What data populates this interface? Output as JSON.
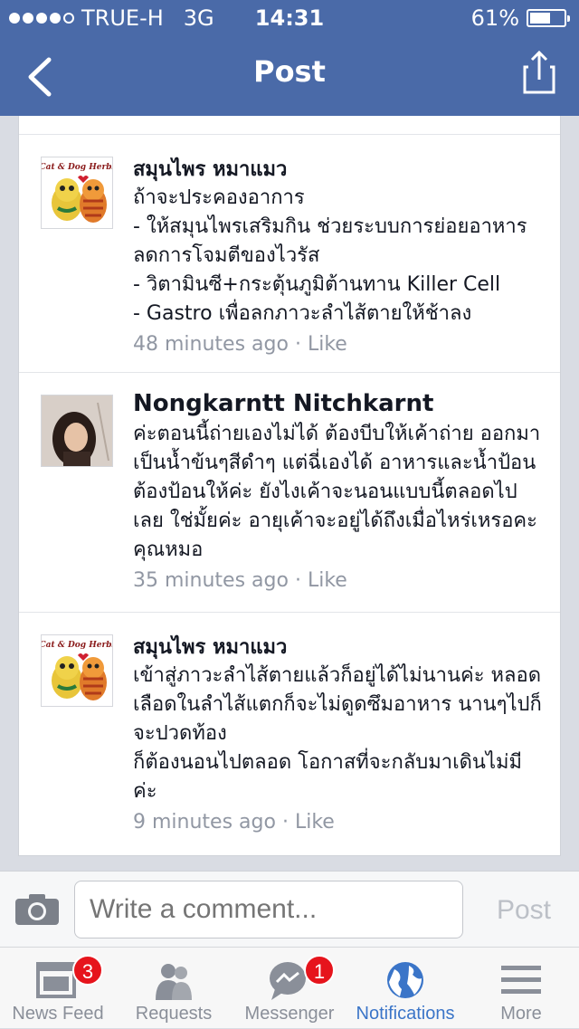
{
  "status_bar": {
    "carrier": "TRUE-H",
    "network": "3G",
    "time": "14:31",
    "battery": "61%",
    "battery_level": 0.61,
    "signal_bars": 4
  },
  "header": {
    "title": "Post",
    "back_icon": "chevron-left-icon",
    "share_icon": "share-icon"
  },
  "comments": [
    {
      "author": "สมุนไพร หมาแมว",
      "text": "ถ้าจะประคองอาการ\n- ให้สมุนไพรเสริมกิน ช่วยระบบการย่อยอาหาร ลดการโจมตีของไวรัส\n- วิตามินซี+กระตุ้นภูมิต้านทาน Killer Cell\n- Gastro เพื่อลกภาวะลำไส้ตายให้ช้าลง",
      "time": "48 minutes ago",
      "like": "Like",
      "avatar": "cat-dog-herbs-logo"
    },
    {
      "author": "Nongkarntt Nitchkarnt",
      "text": "ค่ะตอนนี้ถ่ายเองไม่ได้ ต้องบีบให้เค้าถ่าย ออกมาเป็นน้ำข้นๆสีดำๆ แต่ฉี่เองได้ อาหารและน้ำป้อนต้องป้อนให้ค่ะ ยังไงเค้าจะนอนแบบนี้ตลอดไปเลย ใช่มั้ยค่ะ อายุเค้าจะอยู่ได้ถึงเมื่อไหร่เหรอคะคุณหมอ",
      "time": "35 minutes ago",
      "like": "Like",
      "avatar": "profile-photo"
    },
    {
      "author": "สมุนไพร หมาแมว",
      "text": "เข้าสู่ภาวะลำไส้ตายแล้วก็อยู่ได้ไม่นานค่ะ หลอดเลือดในลำไส้แตกก็จะไม่ดูดซึมอาหาร  นานๆไปก็จะปวดท้อง\nก็ต้องนอนไปตลอด   โอกาสที่จะกลับมาเดินไม่มีค่ะ",
      "time": "9 minutes ago",
      "like": "Like",
      "avatar": "cat-dog-herbs-logo"
    }
  ],
  "logo_text": "Cat & Dog Herbs",
  "composer": {
    "placeholder": "Write a comment...",
    "post_label": "Post",
    "camera_icon": "camera-icon"
  },
  "tabbar": [
    {
      "label": "News Feed",
      "icon": "news-feed-icon",
      "badge": "3"
    },
    {
      "label": "Requests",
      "icon": "requests-icon",
      "badge": ""
    },
    {
      "label": "Messenger",
      "icon": "messenger-icon",
      "badge": "1"
    },
    {
      "label": "Notifications",
      "icon": "globe-icon",
      "badge": "",
      "active": true
    },
    {
      "label": "More",
      "icon": "more-icon",
      "badge": ""
    }
  ],
  "colors": {
    "header": "#4a6aa8",
    "active_tab": "#3b75c8",
    "badge": "#e6141c",
    "meta_text": "#9197a3"
  }
}
